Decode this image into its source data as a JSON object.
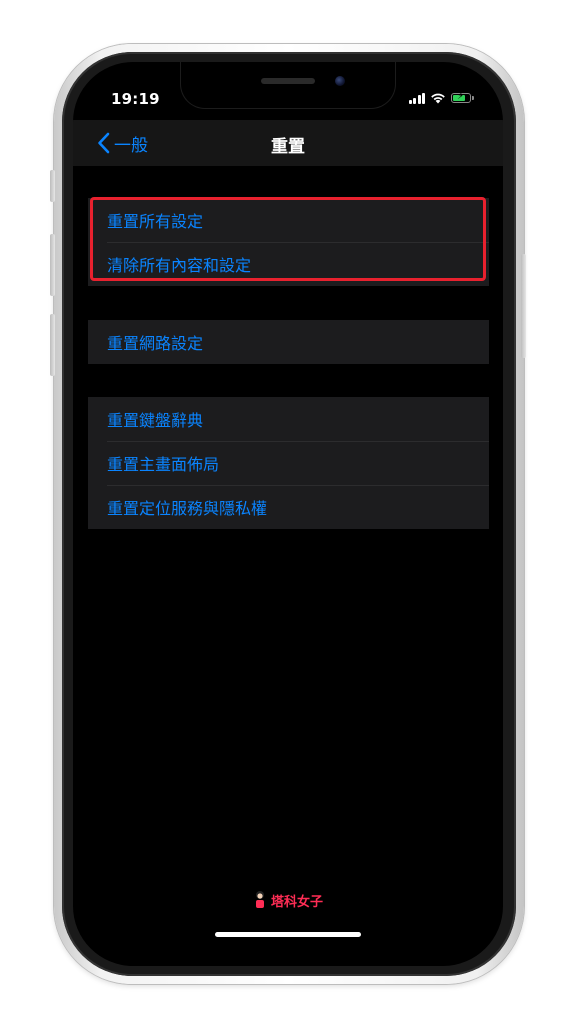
{
  "status_bar": {
    "time": "19:19"
  },
  "nav": {
    "back_label": "一般",
    "title": "重置"
  },
  "groups": [
    {
      "items": [
        {
          "label": "重置所有設定"
        },
        {
          "label": "清除所有內容和設定"
        }
      ],
      "highlighted": true
    },
    {
      "items": [
        {
          "label": "重置網路設定"
        }
      ]
    },
    {
      "items": [
        {
          "label": "重置鍵盤辭典"
        },
        {
          "label": "重置主畫面佈局"
        },
        {
          "label": "重置定位服務與隱私權"
        }
      ]
    }
  ],
  "watermark": {
    "text": "塔科女子"
  },
  "colors": {
    "accent": "#0a84ff",
    "highlight": "#e8212e",
    "background": "#000000",
    "cell": "#1c1c1e",
    "battery": "#30d158",
    "watermark": "#ff2d55"
  },
  "icons": [
    "chevron-left-icon",
    "cellular-signal-icon",
    "wifi-icon",
    "battery-charging-icon"
  ]
}
